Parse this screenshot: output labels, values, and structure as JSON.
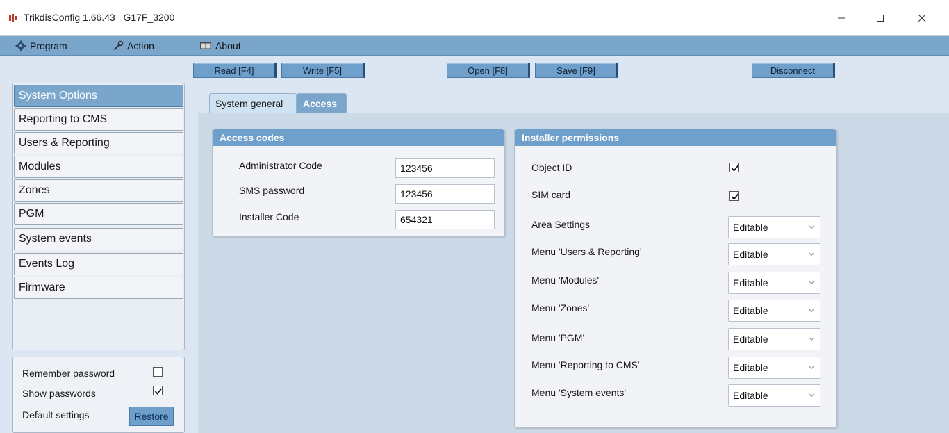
{
  "window": {
    "title": "TrikdisConfig 1.66.43   G17F_3200",
    "accent_color": "#7ba6cb"
  },
  "menu": {
    "program": "Program",
    "action": "Action",
    "about": "About"
  },
  "toolbar": {
    "read": "Read [F4]",
    "write": "Write [F5]",
    "open": "Open [F8]",
    "save": "Save [F9]",
    "disconnect": "Disconnect"
  },
  "sidebar": {
    "items": [
      {
        "label": "System Options",
        "active": true
      },
      {
        "label": "Reporting to CMS"
      },
      {
        "label": "Users & Reporting"
      },
      {
        "label": "Modules"
      },
      {
        "label": "Zones"
      },
      {
        "label": "PGM"
      },
      {
        "label": "System events"
      },
      {
        "label": "Events Log"
      },
      {
        "label": "Firmware"
      }
    ]
  },
  "bottom": {
    "remember_password": {
      "label": "Remember password",
      "checked": false
    },
    "show_passwords": {
      "label": "Show passwords",
      "checked": true
    },
    "default_settings": {
      "label": "Default settings",
      "button": "Restore"
    }
  },
  "tabs": [
    {
      "label": "System general",
      "active": false
    },
    {
      "label": "Access",
      "active": true
    }
  ],
  "access_codes": {
    "title": "Access codes",
    "fields": [
      {
        "label": "Administrator Code",
        "value": "123456"
      },
      {
        "label": "SMS password",
        "value": "123456"
      },
      {
        "label": "Installer Code",
        "value": "654321"
      }
    ]
  },
  "installer_permissions": {
    "title": "Installer permissions",
    "checks": [
      {
        "label": "Object ID",
        "checked": true
      },
      {
        "label": "SIM card",
        "checked": true
      }
    ],
    "selects": [
      {
        "label": "Area Settings",
        "value": "Editable"
      },
      {
        "label": "Menu 'Users & Reporting'",
        "value": "Editable"
      },
      {
        "label": "Menu 'Modules'",
        "value": "Editable"
      },
      {
        "label": "Menu 'Zones'",
        "value": "Editable"
      },
      {
        "label": "Menu 'PGM'",
        "value": "Editable"
      },
      {
        "label": "Menu 'Reporting to CMS'",
        "value": "Editable"
      },
      {
        "label": "Menu 'System events'",
        "value": "Editable"
      }
    ]
  }
}
